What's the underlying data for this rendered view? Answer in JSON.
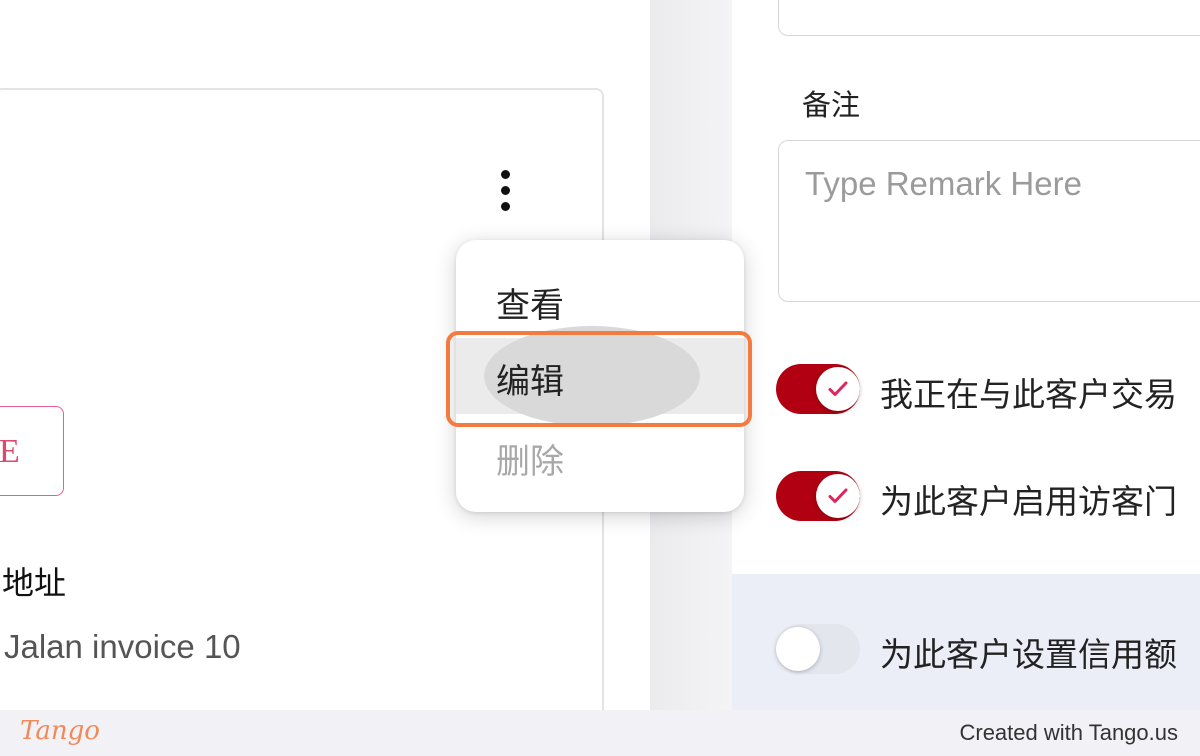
{
  "card": {
    "status_text": "E",
    "address_label": "地址",
    "address_value": "Jalan invoice 10"
  },
  "menu": {
    "items": [
      {
        "label": "查看"
      },
      {
        "label": "编辑"
      },
      {
        "label": "删除"
      }
    ]
  },
  "form": {
    "remark_label": "备注",
    "remark_placeholder": "Type Remark Here",
    "toggles": [
      {
        "label": "我正在与此客户交易",
        "on": true
      },
      {
        "label": "为此客户启用访客门",
        "on": true
      },
      {
        "label": "为此客户设置信用额",
        "on": false
      }
    ]
  },
  "footer": {
    "logo": "Tango",
    "credit": "Created with Tango.us"
  },
  "colors": {
    "toggle_on": "#b00012",
    "check": "#e0245e",
    "highlight": "#f47a40",
    "status_badge": "#e0476f"
  }
}
